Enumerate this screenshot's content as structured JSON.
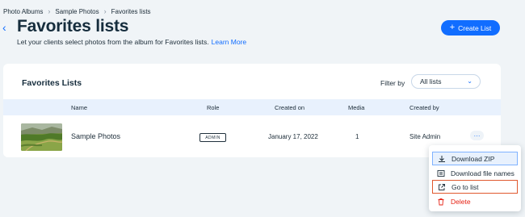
{
  "breadcrumb": [
    "Photo Albums",
    "Sample Photos",
    "Favorites lists"
  ],
  "header": {
    "title": "Favorites lists",
    "subtitle": "Let your clients select photos from the album for Favorites lists.",
    "learn_more": "Learn More",
    "create_button": "Create List"
  },
  "card": {
    "title": "Favorites Lists",
    "filter_label": "Filter by",
    "filter_value": "All lists"
  },
  "table": {
    "columns": [
      "Name",
      "Role",
      "Created on",
      "Media",
      "Created by"
    ],
    "rows": [
      {
        "name": "Sample Photos",
        "role": "ADMIN",
        "created_on": "January 17, 2022",
        "media": "1",
        "created_by": "Site Admin",
        "more": "···"
      }
    ]
  },
  "menu": {
    "items": [
      {
        "label": "Download ZIP",
        "icon": "download-icon"
      },
      {
        "label": "Download file names",
        "icon": "list-icon"
      },
      {
        "label": "Go to list",
        "icon": "external-link-icon"
      },
      {
        "label": "Delete",
        "icon": "trash-icon"
      }
    ]
  },
  "colors": {
    "accent": "#116dff",
    "background": "#f0f4f7",
    "table_header": "#e8f1fd",
    "highlight_border": "#e0582e",
    "danger": "#e62214"
  }
}
